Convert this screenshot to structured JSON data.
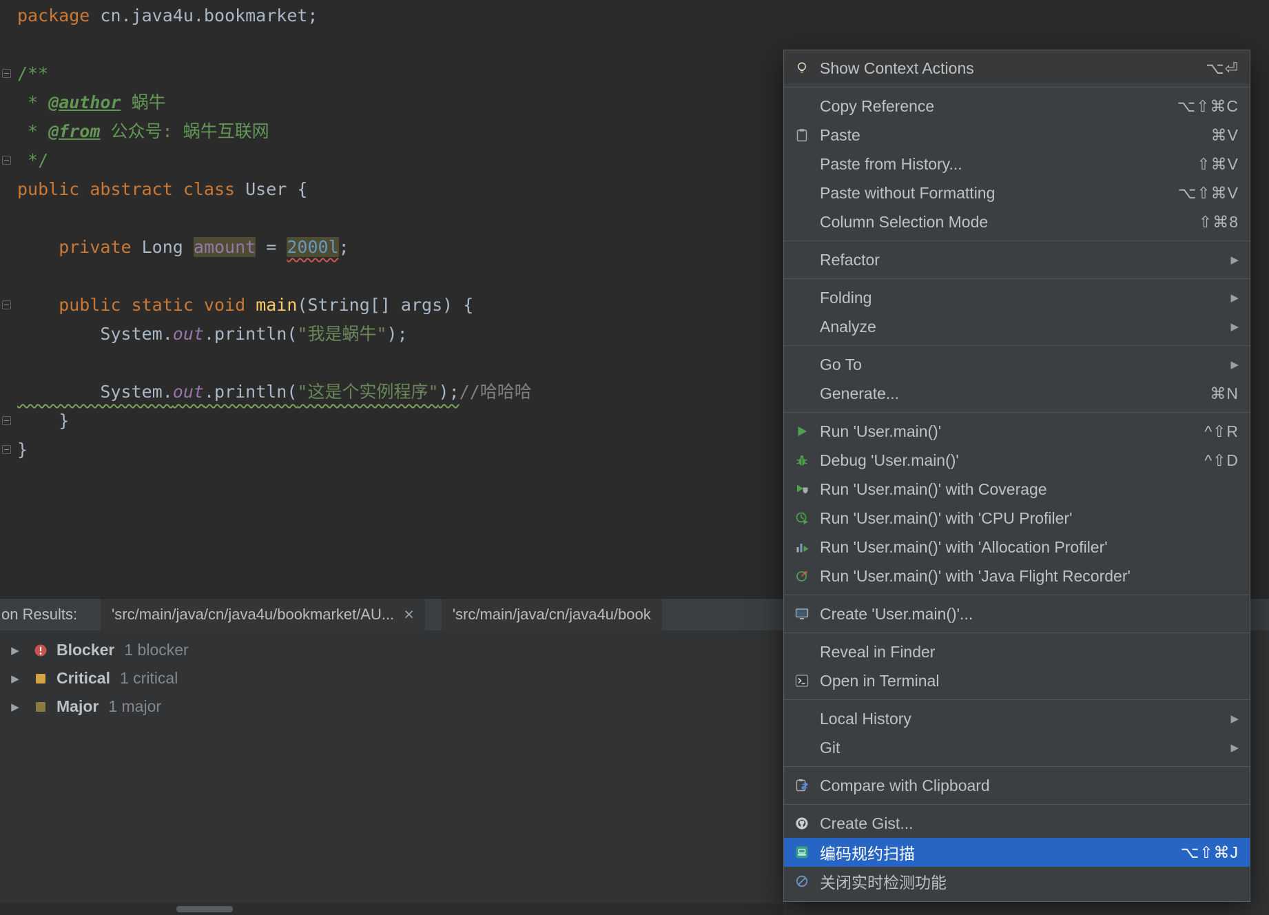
{
  "colors": {
    "editor_bg": "#2b2b2b",
    "menu_bg": "#3c3f41",
    "menu_selection": "#2665c4",
    "keyword_orange": "#cc7832",
    "string_green": "#6a8759",
    "number_blue": "#6897bb",
    "run_green": "#4da14d",
    "blocker_red": "#c75450",
    "critical_amber": "#d6a243",
    "major_olive": "#8a7b43"
  },
  "code": {
    "line1": {
      "kw": "package",
      "rest": " cn.java4u.bookmarket;"
    },
    "line3": {
      "doc": "/**"
    },
    "line4": {
      "pre": " * ",
      "tag": "@author",
      "text": " 蜗牛"
    },
    "line5": {
      "pre": " * ",
      "tag": "@from",
      "text": " 公众号: 蜗牛互联网"
    },
    "line6": {
      "doc": " */"
    },
    "line7": {
      "kw": "public abstract class",
      "rest": " User {"
    },
    "line9": {
      "kw": "    private",
      "type": " Long ",
      "field": "amount",
      "eq": " = ",
      "num": "2000l",
      "end": ";"
    },
    "line11": {
      "kw": "    public static void ",
      "method": "main",
      "rest": "(String[] args) {"
    },
    "line12": {
      "a": "        System.",
      "out": "out",
      "b": ".println(",
      "str": "\"我是蜗牛\"",
      "c": ");"
    },
    "line14": {
      "a": "        System.",
      "out": "out",
      "b": ".println(",
      "str": "\"这是个实例程序\"",
      "c": ");",
      "comment": "//哈哈哈"
    },
    "line15": {
      "t": "    }"
    },
    "line16": {
      "t": "}"
    }
  },
  "menu": {
    "submenu_glyph": "▶",
    "items": [
      {
        "label": "Show Context Actions",
        "shortcut": "⌥⏎",
        "icon": "lightbulb"
      },
      {
        "label": "Copy Reference",
        "shortcut": "⌥⇧⌘C"
      },
      {
        "label": "Paste",
        "shortcut": "⌘V",
        "icon": "paste"
      },
      {
        "label": "Paste from History...",
        "shortcut": "⇧⌘V"
      },
      {
        "label": "Paste without Formatting",
        "shortcut": "⌥⇧⌘V"
      },
      {
        "label": "Column Selection Mode",
        "shortcut": "⇧⌘8"
      },
      {
        "label": "Refactor",
        "submenu": true
      },
      {
        "label": "Folding",
        "submenu": true
      },
      {
        "label": "Analyze",
        "submenu": true
      },
      {
        "label": "Go To",
        "submenu": true
      },
      {
        "label": "Generate...",
        "shortcut": "⌘N"
      },
      {
        "label": "Run 'User.main()'",
        "shortcut": "^⇧R",
        "icon": "run"
      },
      {
        "label": "Debug 'User.main()'",
        "shortcut": "^⇧D",
        "icon": "debug"
      },
      {
        "label": "Run 'User.main()' with Coverage",
        "icon": "run-coverage"
      },
      {
        "label": "Run 'User.main()' with 'CPU Profiler'",
        "icon": "cpu-profiler"
      },
      {
        "label": "Run 'User.main()' with 'Allocation Profiler'",
        "icon": "allocation-profiler"
      },
      {
        "label": "Run 'User.main()' with 'Java Flight Recorder'",
        "icon": "flight-recorder"
      },
      {
        "label": "Create 'User.main()'...",
        "icon": "monitor"
      },
      {
        "label": "Reveal in Finder"
      },
      {
        "label": "Open in Terminal",
        "icon": "terminal"
      },
      {
        "label": "Local History",
        "submenu": true
      },
      {
        "label": "Git",
        "submenu": true
      },
      {
        "label": "Compare with Clipboard",
        "icon": "compare-clipboard"
      },
      {
        "label": "Create Gist...",
        "icon": "github"
      },
      {
        "label": "编码规约扫描",
        "shortcut": "⌥⇧⌘J",
        "icon": "code-scan",
        "selected": true
      },
      {
        "label": "关闭实时检测功能",
        "icon": "disable"
      }
    ]
  },
  "inspection": {
    "title_partial": "on Results:",
    "expand_glyph": "▶",
    "tabs": [
      {
        "label": "'src/main/java/cn/java4u/bookmarket/AU...",
        "close_glyph": "×"
      },
      {
        "label": "'src/main/java/cn/java4u/book"
      }
    ],
    "rows": [
      {
        "severity": "Blocker",
        "count": "1 blocker"
      },
      {
        "severity": "Critical",
        "count": "1 critical"
      },
      {
        "severity": "Major",
        "count": "1 major"
      }
    ]
  }
}
